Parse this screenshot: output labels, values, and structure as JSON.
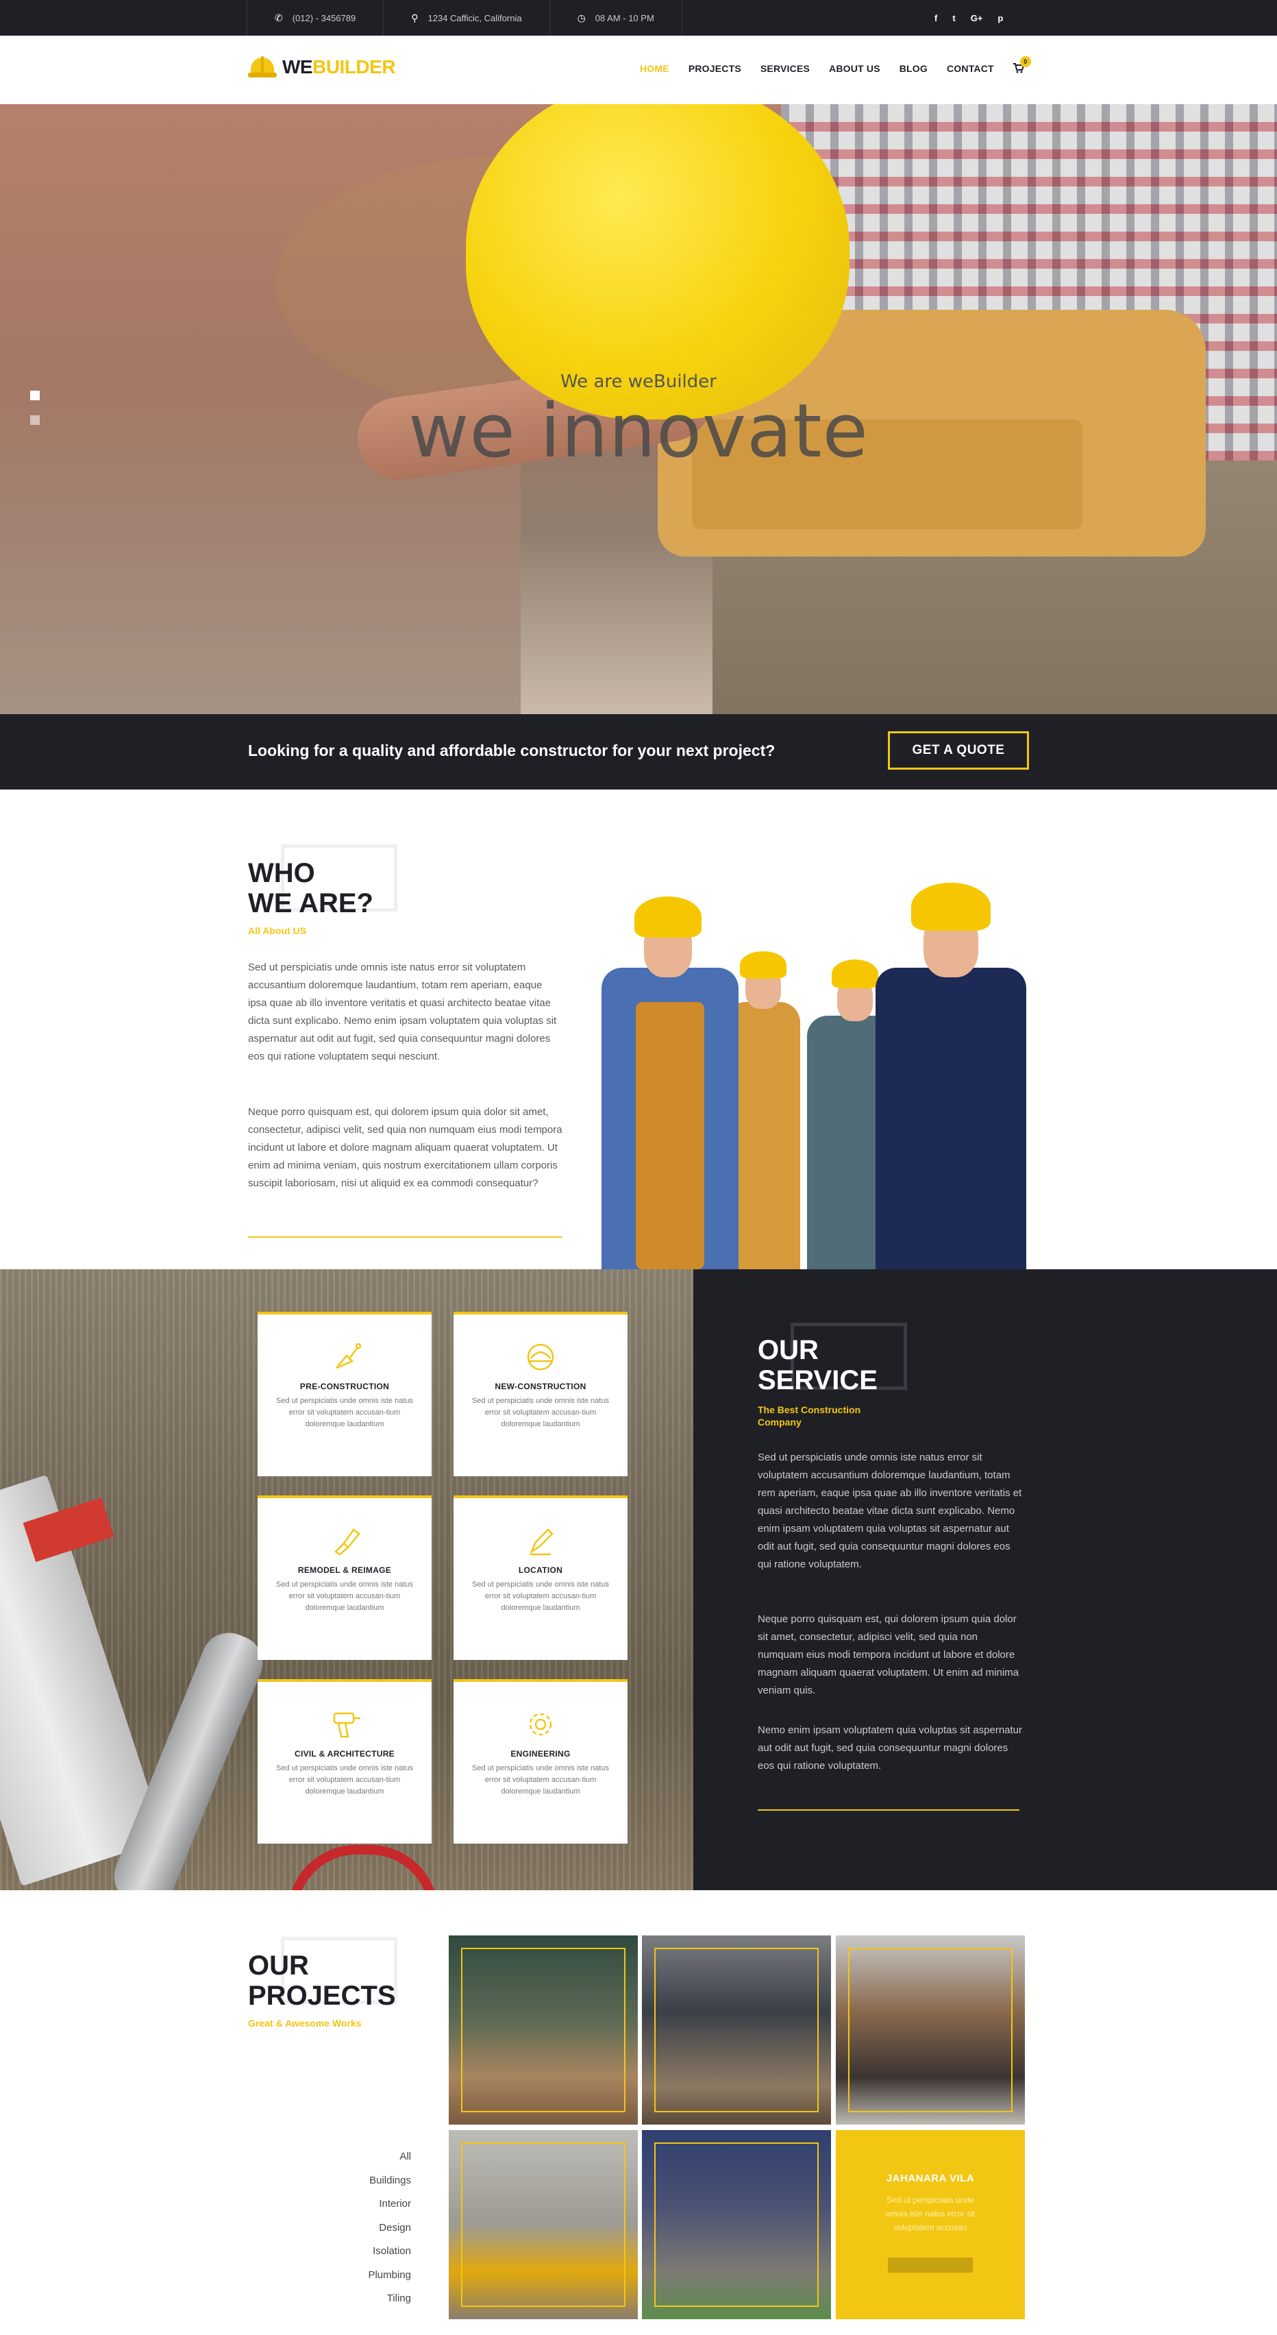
{
  "topbar": {
    "phone": "(012) - 3456789",
    "address": "1234 Cafficic, California",
    "hours": "08 AM - 10 PM",
    "social": [
      "f",
      "t",
      "G+",
      "p"
    ]
  },
  "logo": {
    "we": "WE",
    "builder": "BUILDER"
  },
  "nav": {
    "items": [
      "HOME",
      "PROJECTS",
      "SERVICES",
      "ABOUT US",
      "BLOG",
      "CONTACT"
    ],
    "active": "HOME",
    "cart_count": "0"
  },
  "hero": {
    "subtitle": "We are weBuilder",
    "title": "we innovate"
  },
  "cta": {
    "text": "Looking for a quality and affordable constructor for your next project?",
    "button": "GET A QUOTE"
  },
  "about": {
    "title_line1": "WHO",
    "title_line2": "WE ARE?",
    "subtitle": "All About US",
    "p1": "Sed ut perspiciatis unde omnis iste natus error sit voluptatem accusantium doloremque laudantium, totam rem aperiam, eaque ipsa quae ab illo inventore veritatis et quasi architecto beatae vitae dicta sunt explicabo. Nemo enim ipsam voluptatem quia voluptas sit aspernatur aut odit aut fugit, sed quia consequuntur magni dolores eos qui ratione voluptatem sequi nesciunt.",
    "p2": "Neque porro quisquam est, qui dolorem ipsum quia dolor sit amet, consectetur, adipisci velit, sed quia non numquam eius modi tempora incidunt ut labore et dolore magnam aliquam quaerat voluptatem. Ut enim ad minima veniam, quis nostrum exercitationem ullam corporis suscipit laboriosam, nisi ut aliquid ex ea commodi consequatur?"
  },
  "services": {
    "cards": [
      {
        "title": "PRE-CONSTRUCTION",
        "icon": "trowel-icon",
        "desc": "Sed ut perspiciatis unde omnis iste natus error sit voluptatem accusan-tium doloremque laudantium"
      },
      {
        "title": "NEW-CONSTRUCTION",
        "icon": "helmet-icon",
        "desc": "Sed ut perspiciatis unde omnis iste natus error sit voluptatem accusan-tium doloremque laudantium"
      },
      {
        "title": "REMODEL & REIMAGE",
        "icon": "paintbrush-icon",
        "desc": "Sed ut perspiciatis unde omnis iste natus error sit voluptatem accusan-tium doloremque laudantium"
      },
      {
        "title": "LOCATION",
        "icon": "location-pen-icon",
        "desc": "Sed ut perspiciatis unde omnis iste natus error sit voluptatem accusan-tium doloremque laudantium"
      },
      {
        "title": "CIVIL & ARCHITECTURE",
        "icon": "drill-icon",
        "desc": "Sed ut perspiciatis unde omnis iste natus error sit voluptatem accusan-tium doloremque laudantium"
      },
      {
        "title": "ENGINEERING",
        "icon": "gear-icon",
        "desc": "Sed ut perspiciatis unde omnis iste natus error sit voluptatem accusan-tium doloremque laudantium"
      }
    ],
    "title_line1": "OUR",
    "title_line2": "SERVICE",
    "subtitle_line1": "The Best Construction",
    "subtitle_line2": "Company",
    "p1": "Sed ut perspiciatis unde omnis iste natus error sit voluptatem accusantium doloremque laudantium, totam rem aperiam, eaque ipsa quae ab illo inventore veritatis et quasi architecto beatae vitae dicta sunt explicabo. Nemo enim ipsam voluptatem quia voluptas sit aspernatur aut odit aut fugit, sed quia consequuntur magni dolores eos qui ratione voluptatem.",
    "p2": "Neque porro quisquam est, qui dolorem ipsum quia dolor sit amet, consectetur, adipisci velit, sed quia non numquam eius modi tempora incidunt ut labore et dolore magnam aliquam quaerat voluptatem. Ut enim ad minima veniam quis.",
    "p3": "Nemo enim ipsam voluptatem quia voluptas sit aspernatur aut odit aut fugit, sed quia consequuntur magni dolores eos qui ratione voluptatem."
  },
  "projects": {
    "title_line1": "OUR",
    "title_line2": "PROJECTS",
    "subtitle": "Great & Awesome Works",
    "filters": [
      "All",
      "Buildings",
      "Interior",
      "Design",
      "Isolation",
      "Plumbing",
      "Tiling"
    ],
    "featured_title": "JAHANARA VILA",
    "featured_desc": "Sed ut perspiciatis unde omnis iste natus error sit voluptatem accusan"
  },
  "colors": {
    "accent": "#f3c614",
    "dark": "#1f2026"
  }
}
